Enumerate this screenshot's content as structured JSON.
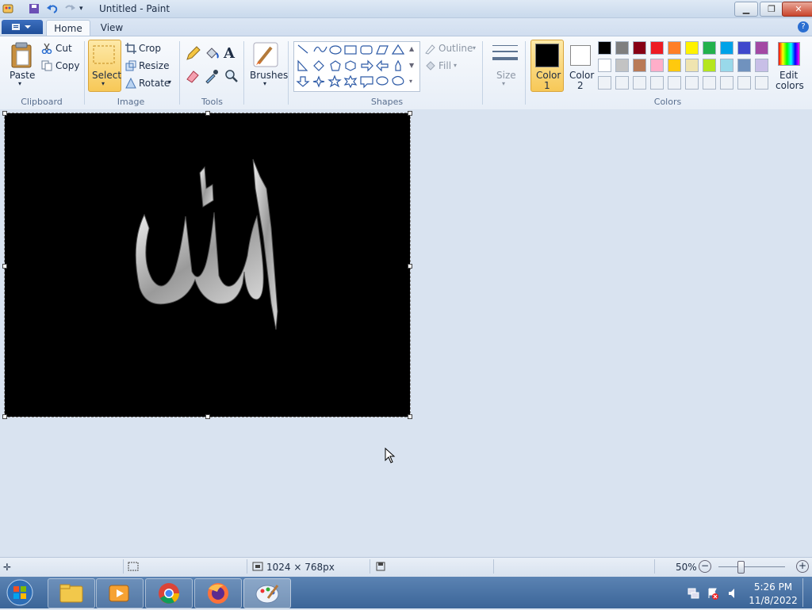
{
  "window": {
    "title": "Untitled - Paint"
  },
  "tabs": [
    {
      "label": "Home"
    },
    {
      "label": "View"
    }
  ],
  "clipboard": {
    "paste": "Paste",
    "cut": "Cut",
    "copy": "Copy",
    "group": "Clipboard"
  },
  "image": {
    "select": "Select",
    "crop": "Crop",
    "resize": "Resize",
    "rotate": "Rotate",
    "group": "Image"
  },
  "tools": {
    "group": "Tools"
  },
  "brushes": {
    "label": "Brushes"
  },
  "shapes": {
    "outline": "Outline",
    "fill": "Fill",
    "group": "Shapes"
  },
  "size": {
    "label": "Size"
  },
  "colors": {
    "color1_line1": "Color",
    "color1_line2": "1",
    "color2_line1": "Color",
    "color2_line2": "2",
    "edit_line1": "Edit",
    "edit_line2": "colors",
    "group": "Colors",
    "color1": "#000000",
    "color2": "#ffffff",
    "palette_row1": [
      "#000000",
      "#7f7f7f",
      "#880015",
      "#ed1c24",
      "#ff7f27",
      "#fff200",
      "#22b14c",
      "#00a2e8",
      "#3f48cc",
      "#a349a4"
    ],
    "palette_row2": [
      "#ffffff",
      "#c3c3c3",
      "#b97a57",
      "#ffaec9",
      "#ffc90e",
      "#efe4b0",
      "#b5e61d",
      "#99d9ea",
      "#7092be",
      "#c8bfe7"
    ]
  },
  "status": {
    "dimensions": "1024 × 768px",
    "zoom": "50%"
  },
  "taskbar": {
    "time": "5:26 PM",
    "date": "11/8/2022"
  }
}
